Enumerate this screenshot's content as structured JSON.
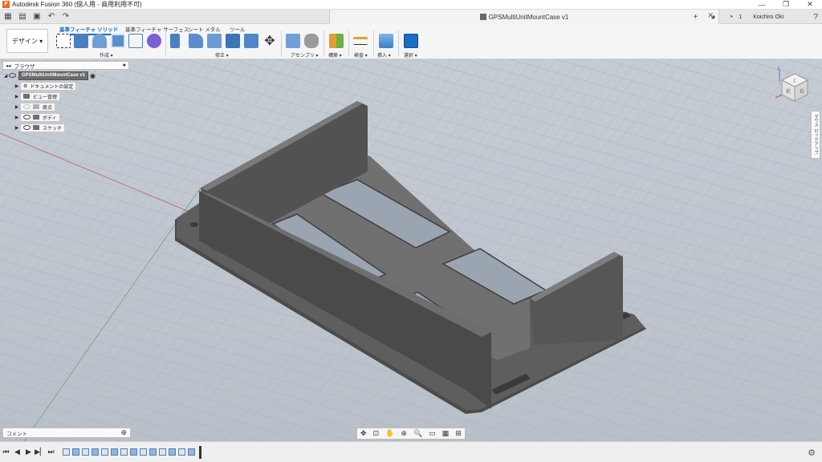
{
  "window": {
    "title": "Autodesk Fusion 360 (個人用 - 商用利用不可)",
    "app_icon": "F"
  },
  "quickbar": {
    "document_title": "GPSMultiUnitMountCase v1",
    "user_name": "Koichiro Oki",
    "job_count": "1"
  },
  "toolbar": {
    "design_label": "デザイン ▾",
    "tabs": [
      "基準フィーチャ ソリッド",
      "基準フィーチャ サーフェス",
      "シート メタル",
      "ツール"
    ],
    "groups": [
      "作成 ▾",
      "修正 ▾",
      "アセンブリ ▾",
      "構築 ▾",
      "検査 ▾",
      "挿入 ▾",
      "選択 ▾"
    ]
  },
  "browser": {
    "header": "ブラウザ",
    "root": "GPSMultiUnitMountCase v1",
    "items": [
      "ドキュメントの設定",
      "ビュー管理",
      "原点",
      "ボディ",
      "スケッチ"
    ]
  },
  "navcube": {
    "side_label": "マウス ロックアップ",
    "top_face": "上",
    "front_face": "前",
    "right_face": "右"
  },
  "comment_bar": {
    "label": "コメント"
  },
  "colors": {
    "accent": "#1a6ec2",
    "viewport_bg": "#bfc5cd",
    "model": "#5c5c5c"
  }
}
